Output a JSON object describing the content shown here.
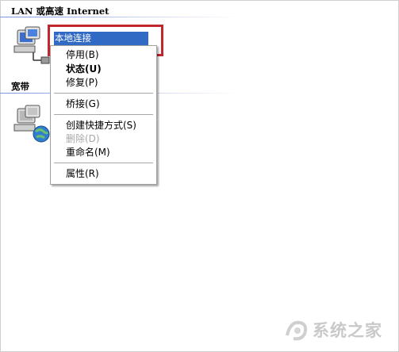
{
  "groups": {
    "lan_header": "LAN 或高速 Internet",
    "broadband_header": "宽带"
  },
  "connection": {
    "selected_label": "本地连接"
  },
  "context_menu": {
    "disable": "停用(B)",
    "status": "状态(U)",
    "repair": "修复(P)",
    "bridge": "桥接(G)",
    "create_shortcut": "创建快捷方式(S)",
    "delete": "删除(D)",
    "rename": "重命名(M)",
    "properties": "属性(R)"
  },
  "colors": {
    "selection": "#316ac5",
    "highlight_border": "#c0282d",
    "header_line": "#7a96df"
  },
  "watermark": {
    "text": "系统之家"
  }
}
